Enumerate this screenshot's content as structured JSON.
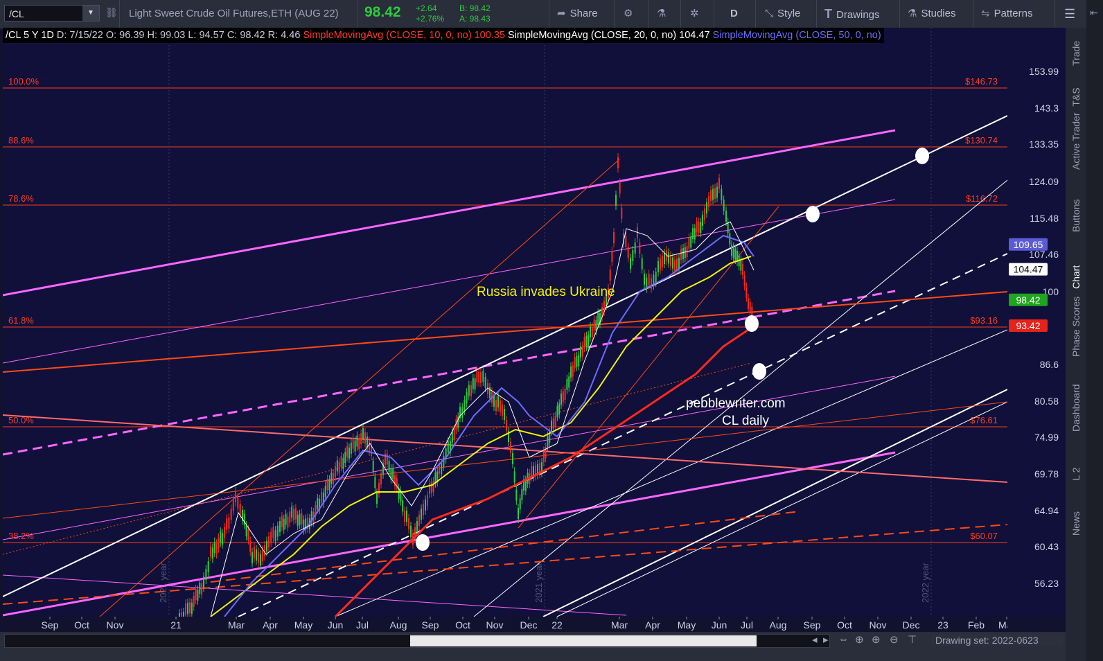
{
  "toolbar": {
    "symbol": "/CL",
    "description": "Light Sweet Crude Oil Futures,ETH (AUG 22)",
    "last": "98.42",
    "change": "+2.64",
    "change_pct": "+2.76%",
    "bid": "B: 98.42",
    "ask": "A: 98.43",
    "share": "Share",
    "period": "D",
    "style": "Style",
    "drawings": "Drawings",
    "studies": "Studies",
    "patterns": "Patterns"
  },
  "study_bar": {
    "symbol_period": "/CL 5 Y 1D",
    "date": "D: 7/15/22",
    "open": "O: 96.39",
    "high": "H: 99.03",
    "low": "L: 94.57",
    "close": "C: 98.42",
    "range": "R: 4.46",
    "sma10_label": "SimpleMovingAvg (CLOSE, 10, 0, no)",
    "sma10_value": "100.35",
    "sma20_label": "SimpleMovingAvg (CLOSE, 20, 0, no)",
    "sma20_value": "104.47",
    "sma50_label": "SimpleMovingAvg (CLOSE, 50, 0, no)"
  },
  "fib_levels": [
    {
      "pct": "100.0%",
      "price": "$146.73",
      "value": 146.73
    },
    {
      "pct": "88.6%",
      "price": "$130.74",
      "value": 130.74
    },
    {
      "pct": "78.6%",
      "price": "$116.72",
      "value": 116.72
    },
    {
      "pct": "61.8%",
      "price": "$93.16",
      "value": 93.16
    },
    {
      "pct": "50.0%",
      "price": "$76.61",
      "value": 76.61
    },
    {
      "pct": "38.2%",
      "price": "$60.07",
      "value": 60.07
    }
  ],
  "y_ticks": [
    "153.99",
    "143.3",
    "133.35",
    "124.09",
    "115.48",
    "107.46",
    "100",
    "86.6",
    "80.58",
    "74.99",
    "69.78",
    "64.94",
    "60.43",
    "56.23"
  ],
  "y_tick_values": [
    153.99,
    143.3,
    133.35,
    124.09,
    115.48,
    107.46,
    100,
    86.6,
    80.58,
    74.99,
    69.78,
    64.94,
    60.43,
    56.23
  ],
  "price_badges": [
    {
      "text": "109.65",
      "value": 109.65,
      "color": "#5b5bd6"
    },
    {
      "text": "104.47",
      "value": 104.47,
      "color": "#ffffff"
    },
    {
      "text": "98.42",
      "value": 98.42,
      "color": "#1fa51f"
    },
    {
      "text": "93.42",
      "value": 93.42,
      "color": "#e4231b"
    }
  ],
  "x_ticks": [
    "Sep",
    "Oct",
    "Nov",
    "21",
    "Mar",
    "Apr",
    "May",
    "Jun",
    "Jul",
    "Aug",
    "Sep",
    "Oct",
    "Nov",
    "Dec",
    "22",
    "Mar",
    "Apr",
    "May",
    "Jun",
    "Jul",
    "Aug",
    "Sep",
    "Oct",
    "Nov",
    "Dec",
    "23",
    "Feb",
    "Mar"
  ],
  "year_markers": [
    "2021 year",
    "2021 year",
    "2022 year"
  ],
  "annotations": {
    "russia": "Russia invades Ukraine",
    "site": "pebblewriter.com",
    "chart_name": "CL daily"
  },
  "sidebar": [
    "Trade",
    "T&S",
    "Active Trader",
    "Buttons",
    "Chart",
    "Phase Scores",
    "Dashboard",
    "L 2",
    "News"
  ],
  "bottom": {
    "drawing_set": "Drawing set: 2022-0623"
  },
  "colors": {
    "background": "#10103a",
    "fib": "#ff3b1f",
    "magenta": "#ff66ff",
    "white": "#ffffff",
    "yellow": "#f4f400",
    "sma50": "#6d6dff"
  }
}
